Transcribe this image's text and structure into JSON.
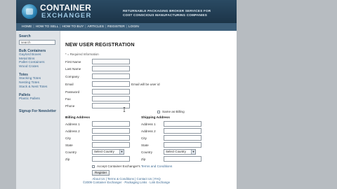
{
  "header": {
    "logo_top": "CONTAINER",
    "logo_bottom": "EXCHANGER",
    "tagline_1": "RETURNABLE PACKAGING BROKER SERVICES FOR",
    "tagline_2": "COST CONSCIOUS MANUFACTURING COMPANIES"
  },
  "nav": {
    "items": [
      "HOME",
      "HOW TO SELL",
      "HOW TO BUY",
      "ARTICLES",
      "REGISTER",
      "LOGIN"
    ]
  },
  "sidebar": {
    "search_title": "Search",
    "search_value": "search",
    "bulk_title": "Bulk Containers",
    "bulk_items": [
      "Gaylord Boxes",
      "Metal Bins",
      "Pallet Containers",
      "Wood Crates"
    ],
    "totes_title": "Totes",
    "totes_items": [
      "Stacking Totes",
      "Nesting Totes",
      "Stack & Nest Totes"
    ],
    "pallets_title": "Pallets",
    "pallets_items": [
      "Plastic Pallets"
    ],
    "newsletter": "Signup For Newsletter"
  },
  "main": {
    "title": "NEW USER REGISTRATION",
    "required_note": "* = Required Information",
    "fields": {
      "first_name": "First Name",
      "last_name": "Last Name",
      "company": "Company",
      "email": "Email",
      "email_note": "Email will be user id",
      "password": "Password",
      "fax": "Fax",
      "phone": "Phone"
    },
    "same_as_billing": "Same as Billing",
    "billing": {
      "title": "Billing Address",
      "address1": "Address 1",
      "address2": "Address 2",
      "city": "City",
      "state": "State",
      "country": "Country",
      "zip": "Zip",
      "country_select": "Select Country"
    },
    "shipping": {
      "title": "Shipping Address",
      "address1": "Address 1",
      "address2": "Address 2",
      "city": "City",
      "state": "State",
      "country": "Country",
      "zip": "Zip",
      "country_select": "Select Country"
    },
    "accept_prefix": "Accept Container Exchanger's",
    "accept_link": "Terms and Conditions",
    "register_button": "Register"
  },
  "footer": {
    "links": "About Us | Terms & Conditions | Contact Us | FAQ",
    "copyright": "©2009 Container Exchanger · Packaging Links · Link Exchange"
  },
  "colors": {
    "header": "#1f3a50",
    "nav": "#3d5f7a",
    "sidebar": "#dfe3e7",
    "link": "#3d6b94",
    "page_bg": "#b7bcc1"
  }
}
